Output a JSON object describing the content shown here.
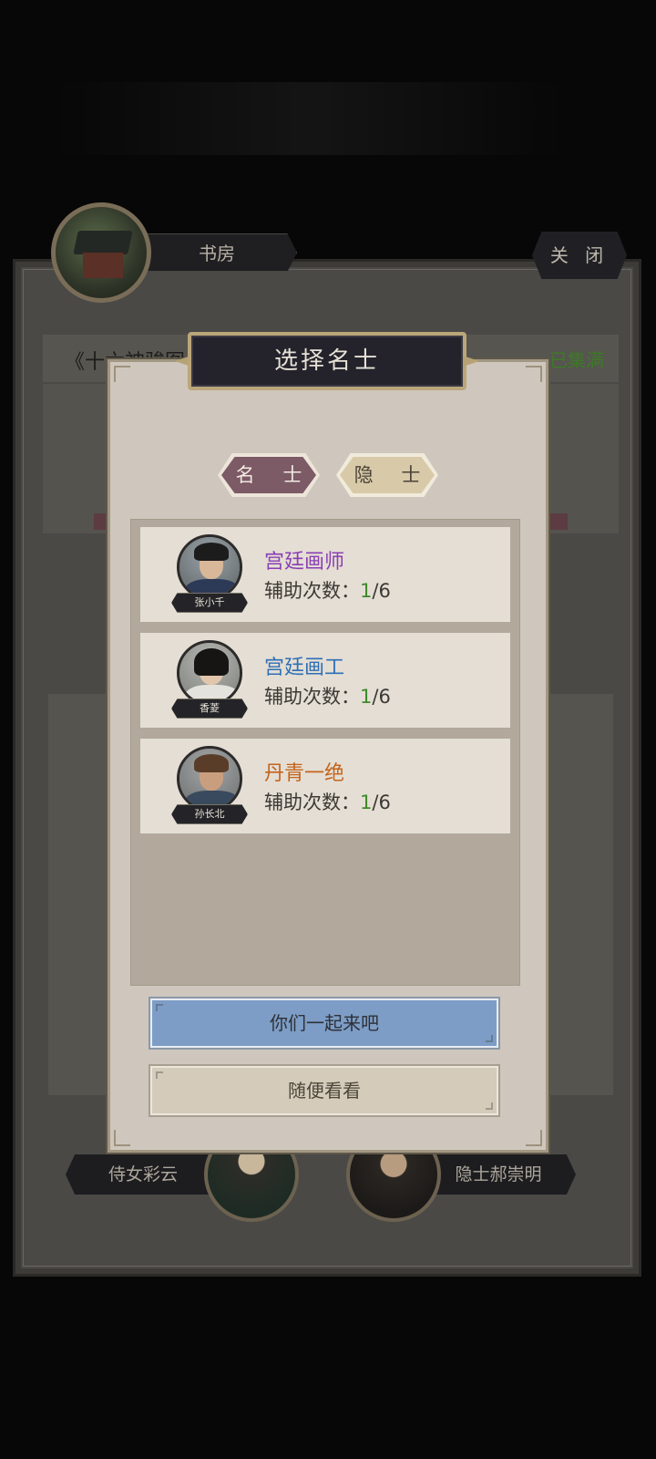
{
  "background": {
    "study_label": "书房",
    "close_label": "关 闭",
    "scroll_title": "《十六神骏图",
    "collected_status": "已集满",
    "attendant_left": "侍女彩云",
    "attendant_right": "隐士郝崇明"
  },
  "modal": {
    "title": "选择名士",
    "tabs": [
      {
        "label": "名 士",
        "active": true
      },
      {
        "label": "隐 士",
        "active": false
      }
    ],
    "cards": [
      {
        "name": "张小千",
        "title": "宫廷画师",
        "title_color": "#8a3fb3",
        "assist_label": "辅助次数：",
        "assist_current": "1",
        "assist_total": "/6"
      },
      {
        "name": "香菱",
        "title": "宫廷画工",
        "title_color": "#2e6fb6",
        "assist_label": "辅助次数：",
        "assist_current": "1",
        "assist_total": "/6"
      },
      {
        "name": "孙长北",
        "title": "丹青一绝",
        "title_color": "#c4641c",
        "assist_label": "辅助次数：",
        "assist_current": "1",
        "assist_total": "/6"
      }
    ],
    "primary_button": "你们一起来吧",
    "secondary_button": "随便看看"
  }
}
